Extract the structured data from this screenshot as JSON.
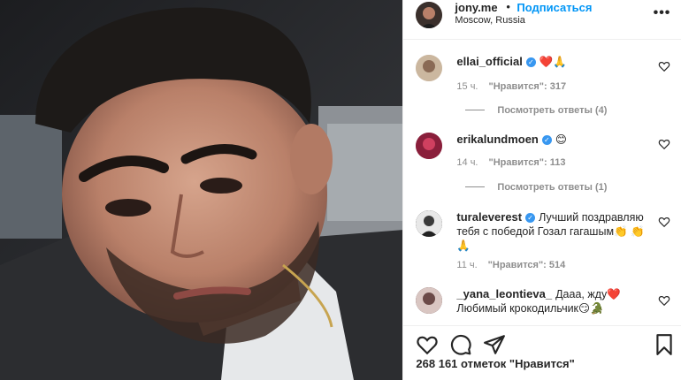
{
  "header": {
    "username": "jony.me",
    "dot": "•",
    "follow_label": "Подписаться",
    "location": "Moscow, Russia",
    "more_icon": "more-dots-icon",
    "more_label": "•••"
  },
  "comments": [
    {
      "username": "ellai_official",
      "verified": true,
      "text": "❤️🙏",
      "time": "15 ч.",
      "likes": "\"Нравится\": 317",
      "replies": "Посмотреть ответы (4)",
      "avatar_color": "#c9b49c"
    },
    {
      "username": "erikalundmoen",
      "verified": true,
      "text": "😊",
      "time": "14 ч.",
      "likes": "\"Нравится\": 113",
      "replies": "Посмотреть ответы (1)",
      "avatar_color": "#8a1f3b"
    },
    {
      "username": "turaleverest",
      "verified": true,
      "text": "Лучший поздравляю тебя с победой Гозал гагашым👏 👏 🙏",
      "time": "11 ч.",
      "likes": "\"Нравится\": 514",
      "avatar_color": "#3a3a3a"
    },
    {
      "username": "_yana_leontieva_",
      "verified": false,
      "text": "Дааа, жду❤️ Любимый крокодильчик😏🐊",
      "avatar_color": "#6b4a48"
    }
  ],
  "actions": {
    "like_icon": "heart-icon",
    "comment_icon": "comment-bubble-icon",
    "share_icon": "send-paper-plane-icon",
    "save_icon": "bookmark-icon"
  },
  "likes_summary": "268 161 отметок \"Нравится\"",
  "verified_glyph": "✓"
}
